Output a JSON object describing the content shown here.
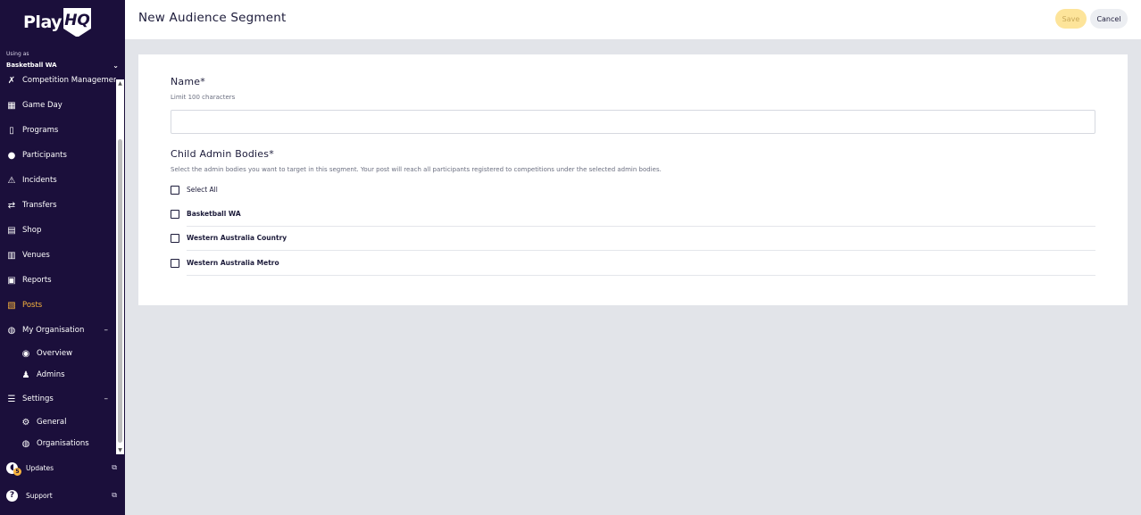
{
  "sidebar": {
    "logo": {
      "play": "Play",
      "hq": "HQ"
    },
    "using_as_label": "Using as",
    "organisation": "Basketball WA",
    "nav": [
      {
        "label": "Competition Management",
        "icon": "competition-icon"
      },
      {
        "label": "Game Day",
        "icon": "scoreboard-icon"
      },
      {
        "label": "Programs",
        "icon": "book-icon"
      },
      {
        "label": "Participants",
        "icon": "people-icon"
      },
      {
        "label": "Incidents",
        "icon": "warning-icon"
      },
      {
        "label": "Transfers",
        "icon": "transfer-icon"
      },
      {
        "label": "Shop",
        "icon": "shop-icon"
      },
      {
        "label": "Venues",
        "icon": "venue-icon"
      },
      {
        "label": "Reports",
        "icon": "reports-icon"
      },
      {
        "label": "Posts",
        "icon": "posts-icon",
        "active": true
      },
      {
        "label": "My Organisation",
        "icon": "globe-icon",
        "toggle": "–"
      },
      {
        "label": "Overview",
        "icon": "overview-icon",
        "sub": true
      },
      {
        "label": "Admins",
        "icon": "admin-icon",
        "sub": true
      },
      {
        "label": "Settings",
        "icon": "settings-icon",
        "toggle": "–"
      },
      {
        "label": "General",
        "icon": "gear-icon",
        "sub": true
      },
      {
        "label": "Organisations",
        "icon": "globe-icon",
        "sub": true
      }
    ],
    "updates": {
      "label": "Updates",
      "badge": "5"
    },
    "support": {
      "label": "Support",
      "icon_glyph": "?"
    }
  },
  "header": {
    "title": "New Audience Segment",
    "save_label": "Save",
    "cancel_label": "Cancel"
  },
  "form": {
    "name_title": "Name*",
    "name_hint": "Limit 100 characters",
    "name_value": "",
    "bodies_title": "Child Admin Bodies*",
    "bodies_hint": "Select the admin bodies you want to target in this segment. Your post will reach all participants registered to competitions under the selected admin bodies.",
    "select_all_label": "Select All",
    "bodies": [
      {
        "label": "Basketball WA",
        "checked": false
      },
      {
        "label": "Western Australia Country",
        "checked": false
      },
      {
        "label": "Western Australia Metro",
        "checked": false
      }
    ]
  },
  "colors": {
    "sidebar_bg": "#1b0f3b",
    "active": "#f9b43d",
    "save_bg": "#fde49a",
    "page_bg": "#e2e4e9"
  }
}
